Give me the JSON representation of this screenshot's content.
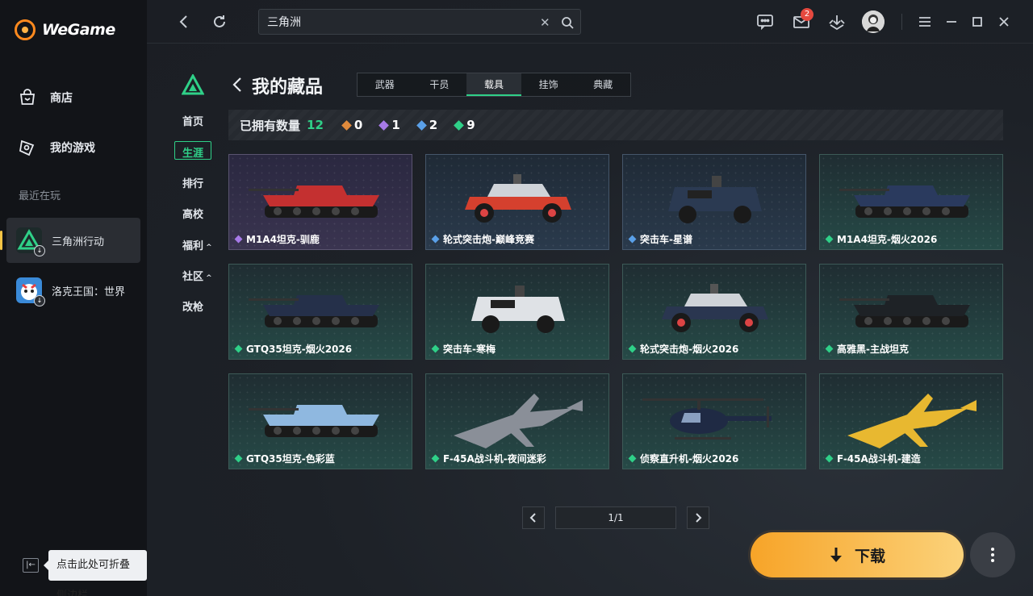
{
  "app": {
    "logo_text": "WeGame"
  },
  "sidebar": {
    "nav": [
      {
        "label": "商店",
        "icon": "store-bag-icon"
      },
      {
        "label": "我的游戏",
        "icon": "gamepad-icon"
      }
    ],
    "recent_title": "最近在玩",
    "recent_games": [
      {
        "label": "三角洲行动",
        "icon": "delta-force-icon",
        "active": true
      },
      {
        "label": "洛克王国：世界",
        "icon": "roco-kingdom-icon",
        "active": false
      }
    ],
    "collapse_tooltip": "点击此处可折叠侧边栏"
  },
  "topbar": {
    "search_value": "三角洲",
    "mail_badge": "2"
  },
  "game_nav": {
    "items": [
      "首页",
      "生涯",
      "排行",
      "高校",
      "福利",
      "社区",
      "改枪"
    ],
    "active": "生涯",
    "expandable": [
      "福利",
      "社区"
    ]
  },
  "page": {
    "title": "我的藏品",
    "tabs": [
      "武器",
      "干员",
      "载具",
      "挂饰",
      "典藏"
    ],
    "active_tab": "载具"
  },
  "summary": {
    "label": "已拥有数量",
    "total": "12",
    "rarity_counts": [
      {
        "rarity": "orange",
        "count": "0"
      },
      {
        "rarity": "purple",
        "count": "1"
      },
      {
        "rarity": "blue",
        "count": "2"
      },
      {
        "rarity": "green",
        "count": "9"
      }
    ]
  },
  "rarity_colors": {
    "orange": "#e08a3c",
    "purple": "#a77ae8",
    "blue": "#5aa0e8",
    "green": "#2fd088"
  },
  "items": [
    {
      "name": "M1A4坦克-驯鹿",
      "rarity": "purple",
      "kind": "tank",
      "color": "#c43030"
    },
    {
      "name": "轮式突击炮-巅峰竞赛",
      "rarity": "blue",
      "kind": "buggy",
      "color": "#d5402e"
    },
    {
      "name": "突击车-星谱",
      "rarity": "blue",
      "kind": "apc",
      "color": "#2b3a52"
    },
    {
      "name": "M1A4坦克-烟火2026",
      "rarity": "green",
      "kind": "tank",
      "color": "#2a3a5e"
    },
    {
      "name": "GTQ35坦克-烟火2026",
      "rarity": "green",
      "kind": "tank",
      "color": "#25304a"
    },
    {
      "name": "突击车-寒梅",
      "rarity": "green",
      "kind": "apc",
      "color": "#dfe2e6"
    },
    {
      "name": "轮式突击炮-烟火2026",
      "rarity": "green",
      "kind": "buggy",
      "color": "#2a3650"
    },
    {
      "name": "高雅黑-主战坦克",
      "rarity": "green",
      "kind": "tank",
      "color": "#1e2226"
    },
    {
      "name": "GTQ35坦克-色彩蓝",
      "rarity": "green",
      "kind": "tank",
      "color": "#8fb8e0"
    },
    {
      "name": "F-45A战斗机-夜间迷彩",
      "rarity": "green",
      "kind": "jet",
      "color": "#8a8f98"
    },
    {
      "name": "侦察直升机-烟火2026",
      "rarity": "green",
      "kind": "heli",
      "color": "#1f2a44"
    },
    {
      "name": "F-45A战斗机-建造",
      "rarity": "green",
      "kind": "jet",
      "color": "#e8b830"
    }
  ],
  "pager": {
    "text": "1/1"
  },
  "download": {
    "label": "下载"
  }
}
